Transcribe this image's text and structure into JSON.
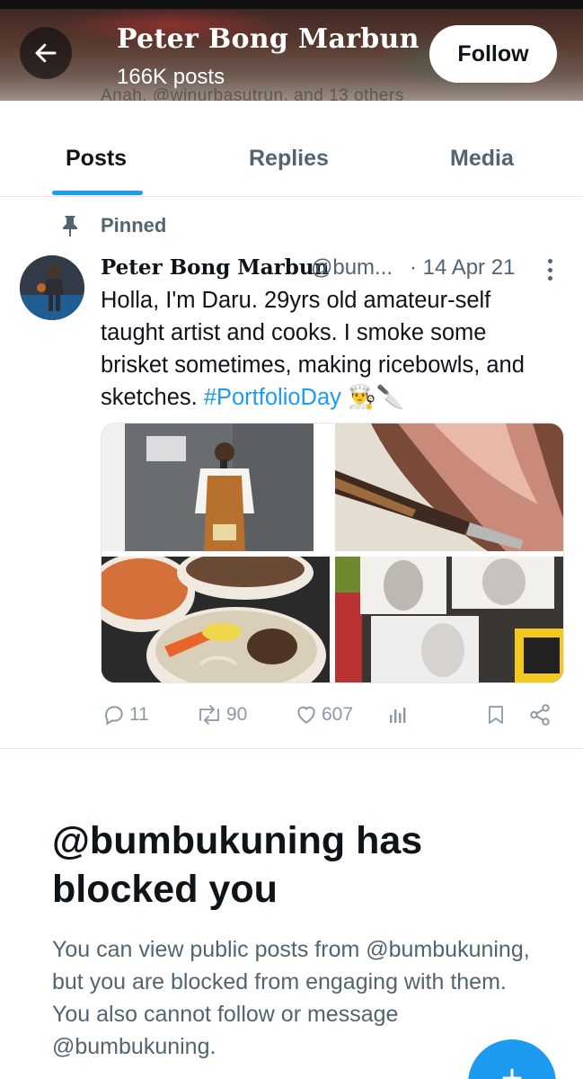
{
  "header": {
    "name": "Peter Bong Marbun",
    "post_count": "166K posts",
    "follow_label": "Follow",
    "faded_subtext": "Anah, @winurbasutrun, and 13 others"
  },
  "tabs": [
    {
      "label": "Posts",
      "active": true
    },
    {
      "label": "Replies",
      "active": false
    },
    {
      "label": "Media",
      "active": false
    }
  ],
  "pinned_post": {
    "pinned_label": "Pinned",
    "author_name": "Peter Bong Marbun",
    "handle": "@bum...",
    "date": "· 14 Apr 21",
    "text_before": "Holla, I'm Daru. 29yrs old amateur-self taught artist and cooks. I smoke some brisket sometimes, making ricebowls, and sketches.",
    "hashtag": "#PortfolioDay",
    "emoji": "👨‍🍳🔪",
    "stats": {
      "replies": "11",
      "reposts": "90",
      "likes": "607"
    }
  },
  "blocked": {
    "title": "@bumbukuning has blocked you",
    "description": "You can view public posts from @bumbukuning, but you are blocked from engaging with them. You also cannot follow or message @bumbukuning."
  },
  "icons": {
    "back": "arrow-left-icon",
    "pin": "pin-icon",
    "more": "more-vertical-icon",
    "reply": "comment-icon",
    "repost": "repost-icon",
    "like": "heart-icon",
    "views": "analytics-icon",
    "bookmark": "bookmark-icon",
    "share": "share-icon",
    "compose": "plus-icon"
  },
  "colors": {
    "accent": "#1d9bf0",
    "text_primary": "#0f1419",
    "text_secondary": "#536471",
    "action_gray": "#8b98a5"
  }
}
